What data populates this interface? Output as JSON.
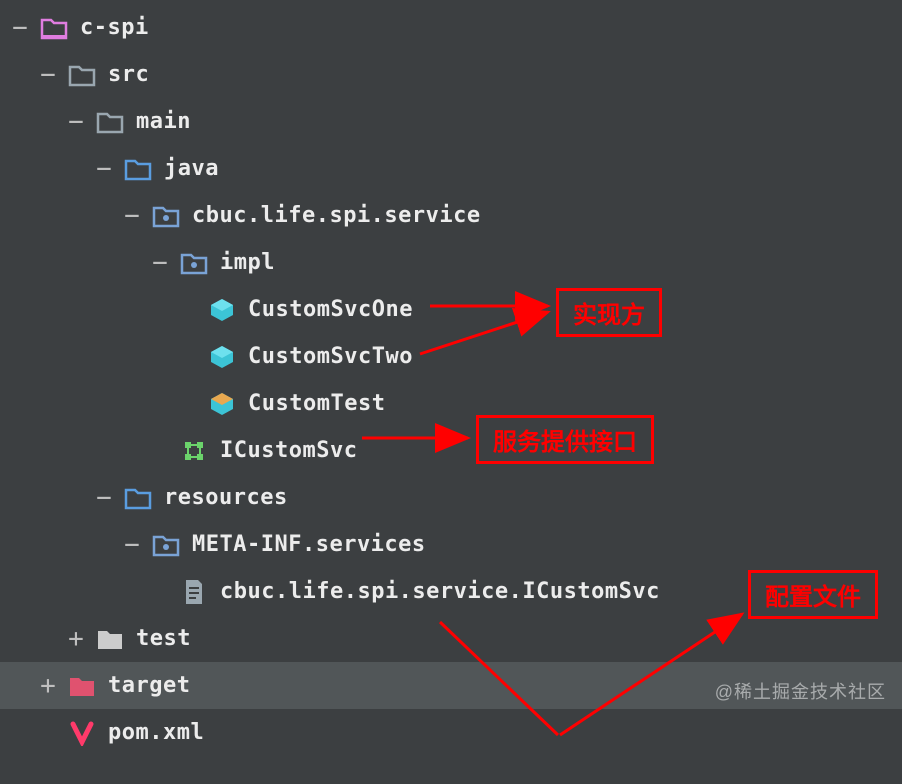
{
  "tree": {
    "root": {
      "toggle": "−",
      "label": "c-spi",
      "icon": "module-folder",
      "color": "#e07de0"
    },
    "src": {
      "toggle": "−",
      "label": "src",
      "icon": "folder-outline",
      "color": "#9aa7b0"
    },
    "main": {
      "toggle": "−",
      "label": "main",
      "icon": "folder-outline",
      "color": "#9aa7b0"
    },
    "java": {
      "toggle": "−",
      "label": "java",
      "icon": "source-folder",
      "color": "#4a88c7"
    },
    "package": {
      "toggle": "−",
      "label": "cbuc.life.spi.service",
      "icon": "package-folder",
      "color": "#7aa3d6"
    },
    "impl": {
      "toggle": "−",
      "label": "impl",
      "icon": "package-folder",
      "color": "#7aa3d6"
    },
    "class1": {
      "label": "CustomSvcOne",
      "icon": "class-icon",
      "color": "#3cc4d6"
    },
    "class2": {
      "label": "CustomSvcTwo",
      "icon": "class-icon",
      "color": "#3cc4d6"
    },
    "class3": {
      "label": "CustomTest",
      "icon": "test-class-icon",
      "color": "#3cc4d6"
    },
    "interface": {
      "label": "ICustomSvc",
      "icon": "interface-icon",
      "color": "#6bd36b"
    },
    "resources": {
      "toggle": "−",
      "label": "resources",
      "icon": "resources-folder",
      "color": "#4a88c7"
    },
    "metainf": {
      "toggle": "−",
      "label": "META-INF.services",
      "icon": "package-folder",
      "color": "#7aa3d6"
    },
    "configfile": {
      "label": "cbuc.life.spi.service.ICustomSvc",
      "icon": "text-file",
      "color": "#9aa7b0"
    },
    "test": {
      "toggle": "+",
      "label": "test",
      "icon": "folder-solid",
      "color": "#cccccc"
    },
    "target": {
      "toggle": "+",
      "label": "target",
      "icon": "excluded-folder",
      "color": "#e0526f"
    },
    "pom": {
      "label": "pom.xml",
      "icon": "maven-icon",
      "color": "#ff3a6a"
    }
  },
  "annotations": {
    "impl_label": "实现方",
    "interface_label": "服务提供接口",
    "config_label": "配置文件"
  },
  "watermark": "@稀土掘金技术社区"
}
